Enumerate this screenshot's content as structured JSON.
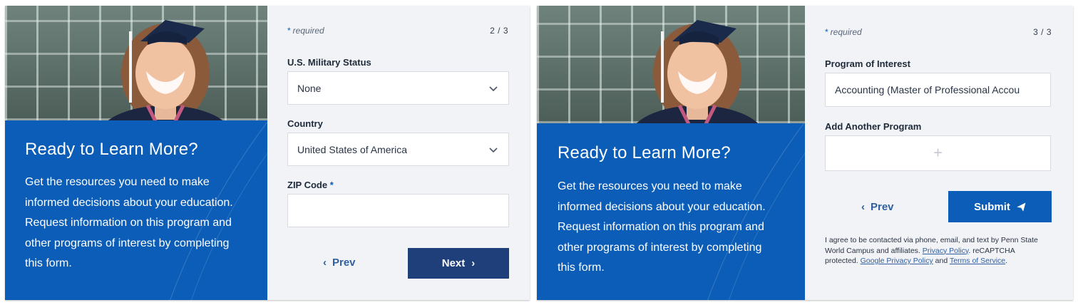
{
  "panel_a": {
    "left": {
      "title": "Ready to Learn More?",
      "body": "Get the resources you need to make informed decisions about your education. Request information on this program and other programs of interest by completing this form."
    },
    "form": {
      "required_label": "required",
      "step": "2 / 3",
      "military": {
        "label": "U.S. Military Status",
        "value": "None"
      },
      "country": {
        "label": "Country",
        "value": "United States of America"
      },
      "zip": {
        "label": "ZIP Code",
        "value": ""
      },
      "prev_label": "Prev",
      "next_label": "Next"
    }
  },
  "panel_b": {
    "left": {
      "title": "Ready to Learn More?",
      "body": "Get the resources you need to make informed decisions about your education. Request information on this program and other programs of interest by completing this form."
    },
    "form": {
      "required_label": "required",
      "step": "3 / 3",
      "program": {
        "label": "Program of Interest",
        "value": "Accounting (Master of Professional Accou"
      },
      "add_program": {
        "label": "Add Another Program",
        "icon": "plus-icon"
      },
      "prev_label": "Prev",
      "submit_label": "Submit",
      "legal": {
        "text_1": "I agree to be contacted via phone, email, and text by Penn State World Campus and affiliates.",
        "privacy_link": "Privacy Policy",
        "text_2": ". reCAPTCHA protected.",
        "google_link": "Google Privacy Policy",
        "and": "and",
        "terms_link": "Terms of Service",
        "end": "."
      }
    }
  },
  "colors": {
    "brand_blue": "#0b5db7",
    "next_button": "#1f3f7a",
    "form_bg": "#f2f3f6",
    "link": "#2f5fa0"
  }
}
